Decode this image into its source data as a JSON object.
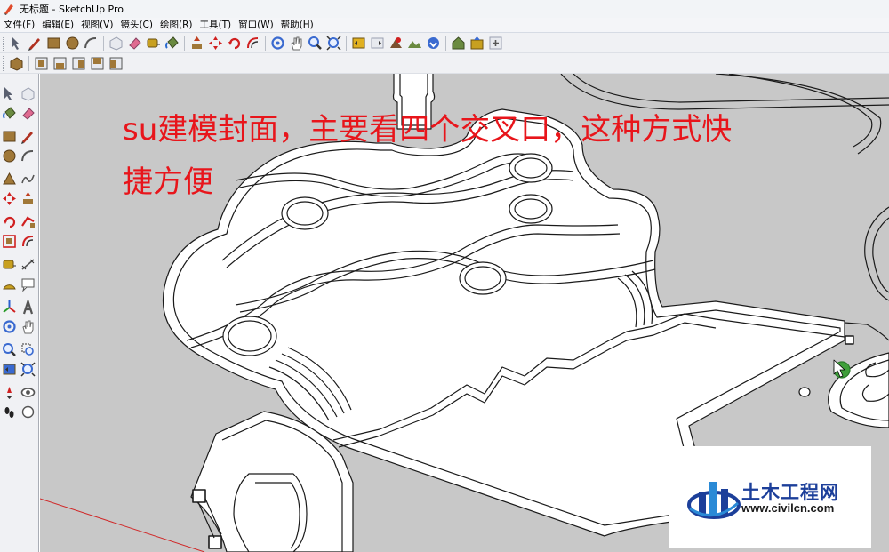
{
  "window": {
    "title": "无标题 - SketchUp Pro"
  },
  "menu": [
    "文件(F)",
    "编辑(E)",
    "视图(V)",
    "镜头(C)",
    "绘图(R)",
    "工具(T)",
    "窗口(W)",
    "帮助(H)"
  ],
  "toolbar_main": [
    {
      "name": "select-icon",
      "color": "#5a6070"
    },
    {
      "name": "pencil-line-icon",
      "color": "#b03020"
    },
    {
      "name": "rectangle-icon",
      "color": "#a07838"
    },
    {
      "name": "circle-icon",
      "color": "#a07838"
    },
    {
      "name": "arc-icon",
      "color": "#555555"
    },
    {
      "sep": true
    },
    {
      "name": "make-component-icon",
      "color": "#9aa0b0"
    },
    {
      "name": "eraser-icon",
      "color": "#e06a90"
    },
    {
      "name": "tape-measure-icon",
      "color": "#c8a020"
    },
    {
      "name": "paint-bucket-icon",
      "color": "#6a8a40"
    },
    {
      "sep": true
    },
    {
      "name": "push-pull-icon",
      "color": "#c04020"
    },
    {
      "name": "move-icon",
      "color": "#d02020"
    },
    {
      "name": "rotate-icon",
      "color": "#d02020"
    },
    {
      "name": "offset-icon",
      "color": "#d02020"
    },
    {
      "sep": true
    },
    {
      "name": "orbit-icon",
      "color": "#3a6ad0"
    },
    {
      "name": "pan-hand-icon",
      "color": "#6a6a6a"
    },
    {
      "name": "zoom-icon",
      "color": "#3a6ad0"
    },
    {
      "name": "zoom-extents-icon",
      "color": "#3a6ad0"
    },
    {
      "sep": true
    },
    {
      "name": "previous-view-icon",
      "color": "#e0b020"
    },
    {
      "name": "next-view-icon",
      "color": "#9aa0b0"
    },
    {
      "name": "add-location-icon",
      "color": "#7a5030"
    },
    {
      "name": "toggle-terrain-icon",
      "color": "#6a8a40"
    },
    {
      "name": "get-models-icon",
      "color": "#3a6ad0"
    },
    {
      "sep": true
    },
    {
      "name": "warehouse-icon",
      "color": "#6a8a40"
    },
    {
      "name": "share-model-icon",
      "color": "#c8a020"
    },
    {
      "name": "extension-icon",
      "color": "#9aa0b0"
    }
  ],
  "toolbar_views": [
    {
      "name": "iso-view-icon",
      "color": "#a07838"
    },
    {
      "sep": true
    },
    {
      "name": "top-view-icon",
      "color": "#a07838"
    },
    {
      "name": "front-view-icon",
      "color": "#a07838"
    },
    {
      "name": "right-view-icon",
      "color": "#a07838"
    },
    {
      "name": "back-view-icon",
      "color": "#a07838"
    },
    {
      "name": "left-view-icon",
      "color": "#a07838"
    }
  ],
  "left_tools": [
    {
      "name": "select-icon",
      "color": "#5a6070"
    },
    {
      "name": "make-component-icon",
      "color": "#9aa0b0"
    },
    {
      "name": "paint-bucket-icon",
      "color": "#6a8a40"
    },
    {
      "name": "eraser-icon",
      "color": "#e06a90"
    },
    {
      "name": "rectangle-icon",
      "color": "#a07838"
    },
    {
      "name": "pencil-line-icon",
      "color": "#b03020"
    },
    {
      "name": "circle-icon",
      "color": "#a07838"
    },
    {
      "name": "arc-icon",
      "color": "#555555"
    },
    {
      "name": "polygon-icon",
      "color": "#a07838"
    },
    {
      "name": "freehand-icon",
      "color": "#555555"
    },
    {
      "name": "move-icon",
      "color": "#d02020"
    },
    {
      "name": "push-pull-icon",
      "color": "#c04020"
    },
    {
      "name": "rotate-icon",
      "color": "#d02020"
    },
    {
      "name": "follow-me-icon",
      "color": "#d02020"
    },
    {
      "name": "scale-icon",
      "color": "#d02020"
    },
    {
      "name": "offset-icon",
      "color": "#d02020"
    },
    {
      "name": "tape-measure-icon",
      "color": "#c8a020"
    },
    {
      "name": "dimension-icon",
      "color": "#555555"
    },
    {
      "name": "protractor-icon",
      "color": "#c8a020"
    },
    {
      "name": "text-icon",
      "color": "#555555"
    },
    {
      "name": "axes-icon",
      "color": "#d02020"
    },
    {
      "name": "3d-text-icon",
      "color": "#555555"
    },
    {
      "name": "orbit-icon",
      "color": "#3a6ad0"
    },
    {
      "name": "pan-hand-icon",
      "color": "#6a6a6a"
    },
    {
      "name": "zoom-icon",
      "color": "#3a6ad0"
    },
    {
      "name": "zoom-window-icon",
      "color": "#3a6ad0"
    },
    {
      "name": "previous-view-icon",
      "color": "#3a6ad0"
    },
    {
      "name": "zoom-extents-icon",
      "color": "#3a6ad0"
    },
    {
      "name": "position-camera-icon",
      "color": "#d02020"
    },
    {
      "name": "look-around-icon",
      "color": "#555555"
    },
    {
      "name": "walk-icon",
      "color": "#222222"
    },
    {
      "name": "section-plane-icon",
      "color": "#555555"
    }
  ],
  "viewport": {
    "background": "#c8c8c8",
    "overlay_text_line1": "su建模封面，主要看四个交叉口，这种方式快",
    "overlay_text_line2": "捷方便",
    "overlay_color": "#e8151b"
  },
  "watermark": {
    "brand": "土木工程网",
    "url": "www.civilcn.com",
    "brand_color": "#1c3f9a"
  }
}
